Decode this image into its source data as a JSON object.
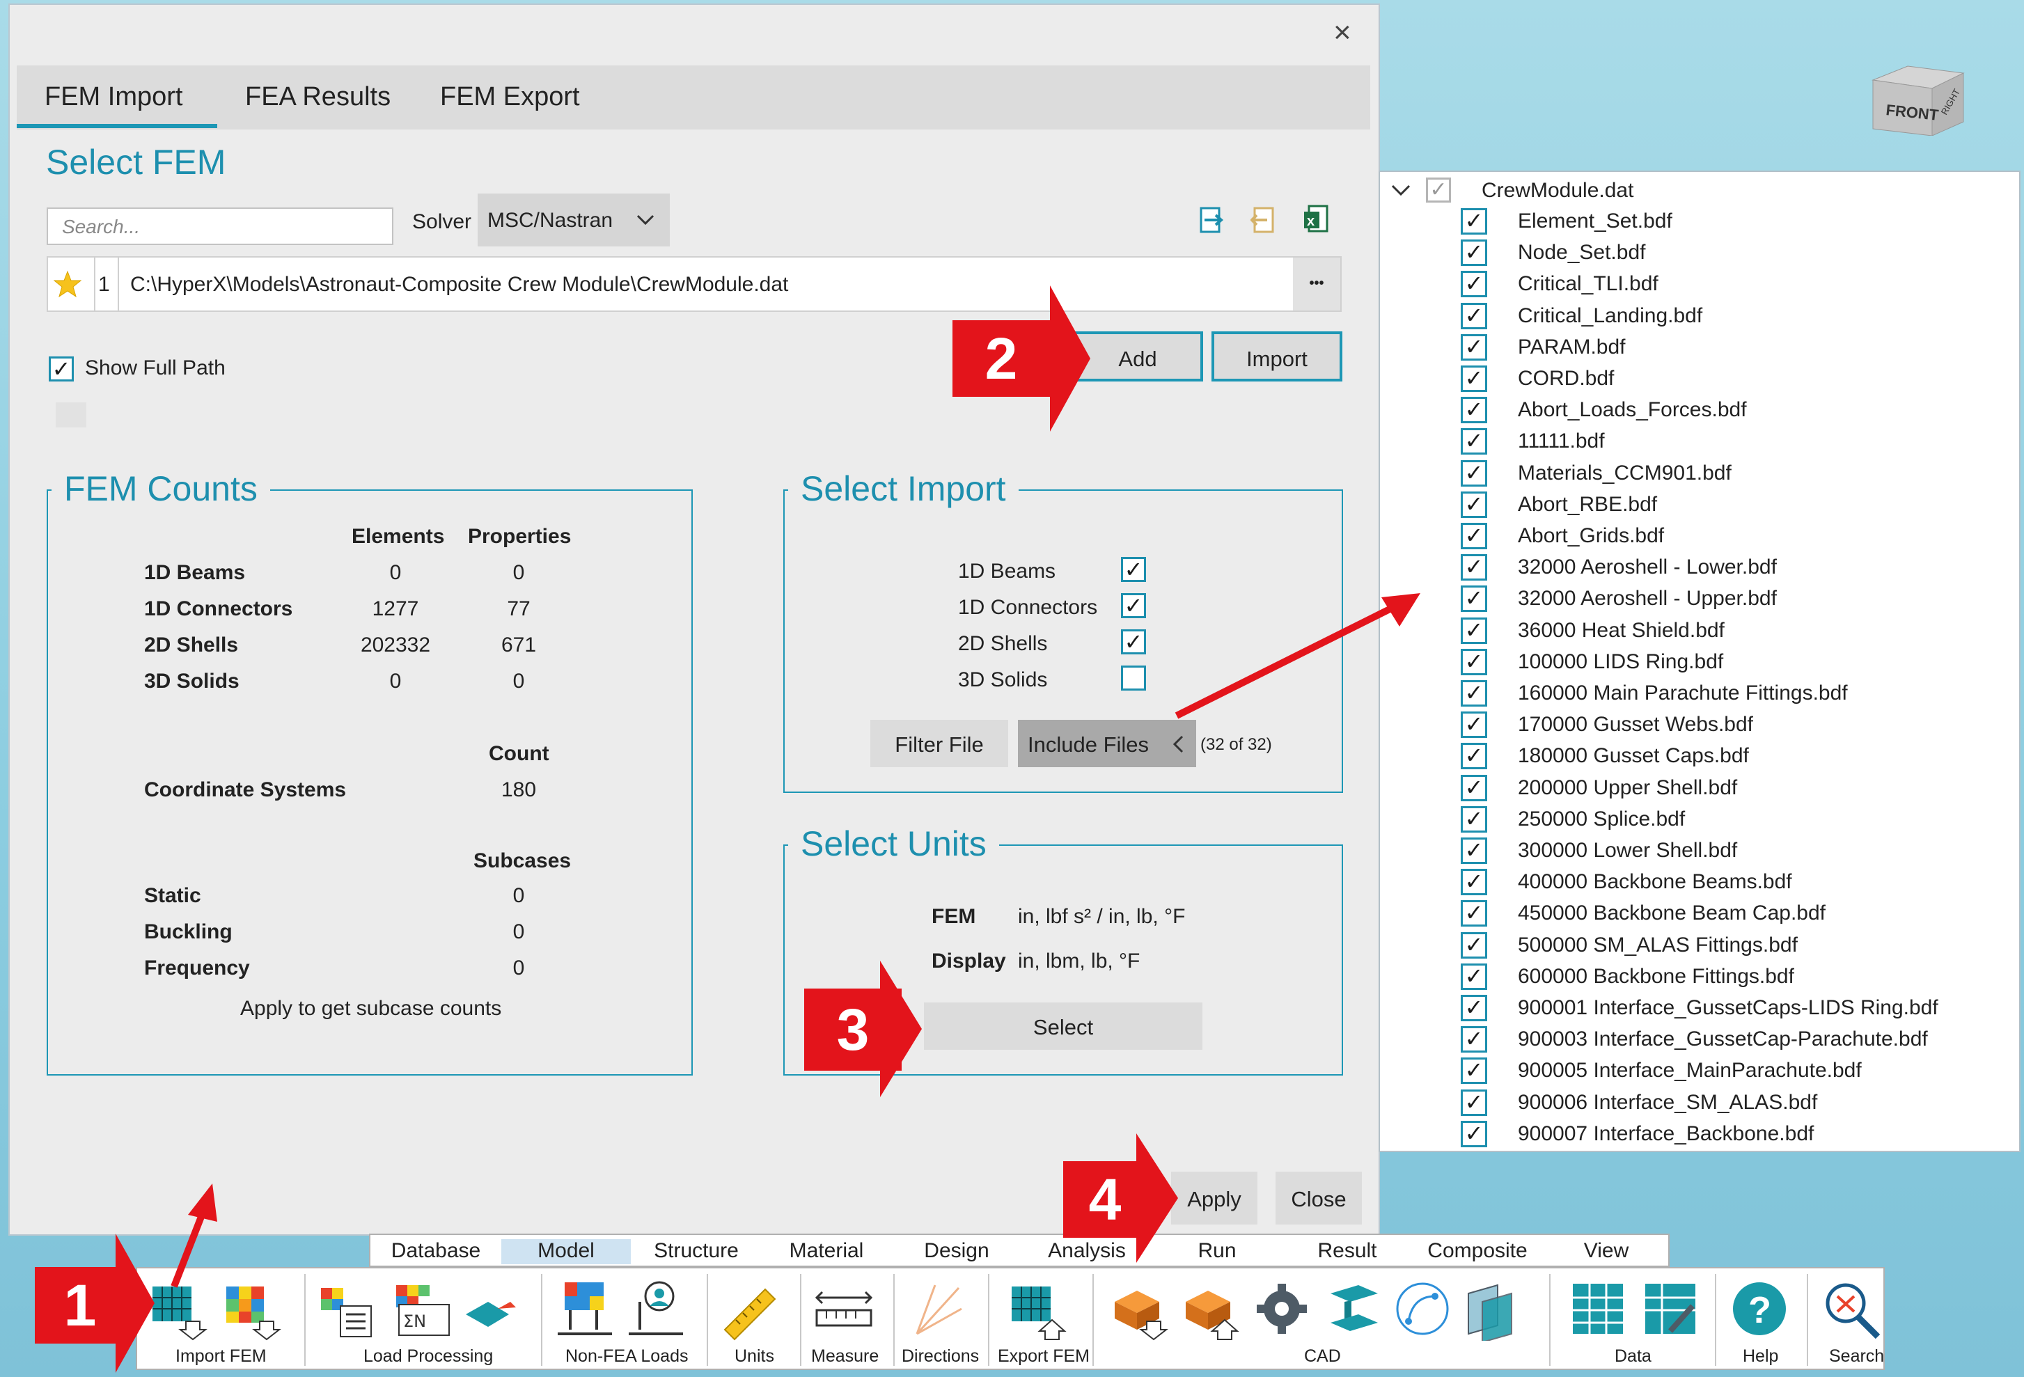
{
  "dialog": {
    "close_glyph": "×",
    "tabs": [
      "FEM Import",
      "FEA Results",
      "FEM Export"
    ],
    "active_tab": "FEM Import",
    "section_title": "Select FEM",
    "search_placeholder": "Search...",
    "solver_label": "Solver",
    "solver_value": "MSC/Nastran",
    "file_row": {
      "index": "1",
      "path": "C:\\HyperX\\Models\\Astronaut-Composite Crew Module\\CrewModule.dat",
      "more": "•••"
    },
    "add_label": "Add",
    "import_label": "Import",
    "show_full_path": {
      "label": "Show Full Path",
      "checked": true
    },
    "apply_label": "Apply",
    "close_label": "Close"
  },
  "fem_counts": {
    "title": "FEM Counts",
    "headers": {
      "elements": "Elements",
      "properties": "Properties"
    },
    "rows": [
      {
        "label": "1D Beams",
        "elements": "0",
        "properties": "0"
      },
      {
        "label": "1D Connectors",
        "elements": "1277",
        "properties": "77"
      },
      {
        "label": "2D Shells",
        "elements": "202332",
        "properties": "671"
      },
      {
        "label": "3D Solids",
        "elements": "0",
        "properties": "0"
      }
    ],
    "count_header": "Count",
    "coord_label": "Coordinate Systems",
    "coord_value": "180",
    "subcases_header": "Subcases",
    "subcases": [
      {
        "label": "Static",
        "value": "0"
      },
      {
        "label": "Buckling",
        "value": "0"
      },
      {
        "label": "Frequency",
        "value": "0"
      }
    ],
    "note": "Apply to get subcase counts"
  },
  "select_import": {
    "title": "Select Import",
    "items": [
      {
        "label": "1D Beams",
        "checked": true
      },
      {
        "label": "1D Connectors",
        "checked": true
      },
      {
        "label": "2D Shells",
        "checked": true
      },
      {
        "label": "3D Solids",
        "checked": false
      }
    ],
    "filter_label": "Filter File",
    "include_label": "Include Files",
    "include_count": "(32 of 32)"
  },
  "select_units": {
    "title": "Select Units",
    "fem_label": "FEM",
    "fem_value": "in, lbf s² / in, lb, °F",
    "display_label": "Display",
    "display_value": "in, lbm, lb, °F",
    "select_label": "Select"
  },
  "include_files": {
    "root": "CrewModule.dat",
    "files": [
      "Element_Set.bdf",
      "Node_Set.bdf",
      "Critical_TLI.bdf",
      "Critical_Landing.bdf",
      "PARAM.bdf",
      "CORD.bdf",
      "Abort_Loads_Forces.bdf",
      "11111.bdf",
      "Materials_CCM901.bdf",
      "Abort_RBE.bdf",
      "Abort_Grids.bdf",
      "32000 Aeroshell - Lower.bdf",
      "32000 Aeroshell - Upper.bdf",
      "36000 Heat Shield.bdf",
      "100000 LIDS Ring.bdf",
      "160000 Main Parachute Fittings.bdf",
      "170000 Gusset Webs.bdf",
      "180000 Gusset Caps.bdf",
      "200000 Upper Shell.bdf",
      "250000 Splice.bdf",
      "300000 Lower Shell.bdf",
      "400000 Backbone Beams.bdf",
      "450000 Backbone Beam Cap.bdf",
      "500000 SM_ALAS Fittings.bdf",
      "600000 Backbone Fittings.bdf",
      "900001 Interface_GussetCaps-LIDS Ring.bdf",
      "900003 Interface_GussetCap-Parachute.bdf",
      "900005 Interface_MainParachute.bdf",
      "900006 Interface_SM_ALAS.bdf",
      "900007 Interface_Backbone.bdf"
    ]
  },
  "viewcube": {
    "front": "FRONT",
    "right": "RIGHT"
  },
  "ribbon": {
    "tabs": [
      "Database",
      "Model",
      "Structure",
      "Material",
      "Design",
      "Analysis",
      "Run",
      "Result",
      "Composite",
      "View"
    ],
    "active_tab": "Model",
    "groups": [
      "Import FEM",
      "Load Processing",
      "Non-FEA Loads",
      "Units",
      "Measure",
      "Directions",
      "Export FEM",
      "CAD",
      "Data",
      "Help",
      "Search"
    ]
  },
  "callouts": [
    "1",
    "2",
    "3",
    "4"
  ],
  "colors": {
    "accent": "#1d97b5",
    "callout_red": "#e3141b",
    "dialog_bg": "#ececec",
    "desktop": "#8ccde0"
  }
}
